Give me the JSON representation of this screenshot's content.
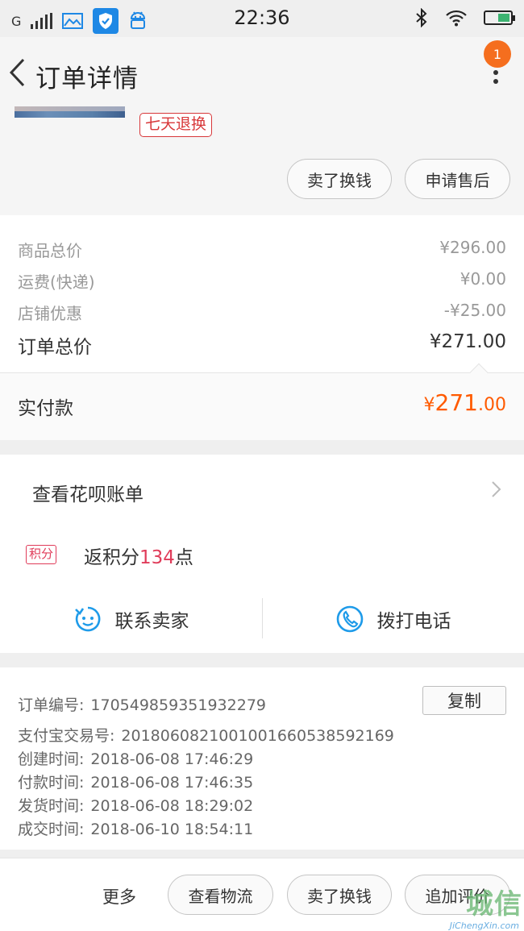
{
  "status_bar": {
    "network": "G",
    "time": "22:36"
  },
  "nav": {
    "title": "订单详情",
    "badge": "1"
  },
  "product": {
    "return_tag": "七天退换",
    "buttons": [
      "卖了换钱",
      "申请售后"
    ]
  },
  "prices": {
    "rows": [
      {
        "label": "商品总价",
        "value": "¥296.00"
      },
      {
        "label": "运费(快递)",
        "value": "¥0.00"
      },
      {
        "label": "店铺优惠",
        "value": "-¥25.00"
      }
    ],
    "total_label": "订单总价",
    "total_value": "¥271.00",
    "paid_label": "实付款",
    "paid_yen": "¥",
    "paid_int": "271",
    "paid_dec": ".00"
  },
  "huabei": {
    "label": "查看花呗账单"
  },
  "points": {
    "tag": "积分",
    "prefix": "返积分",
    "number": "134",
    "suffix": "点"
  },
  "contact": {
    "seller": "联系卖家",
    "phone": "拨打电话"
  },
  "order_info": {
    "copy_label": "复制",
    "rows": [
      {
        "key": "订单编号:",
        "value": "170549859351932279"
      },
      {
        "key": "支付宝交易号:",
        "value": "2018060821001001660538592169"
      },
      {
        "key": "创建时间:",
        "value": "2018-06-08 17:46:29"
      },
      {
        "key": "付款时间:",
        "value": "2018-06-08 17:46:35"
      },
      {
        "key": "发货时间:",
        "value": "2018-06-08 18:29:02"
      },
      {
        "key": "成交时间:",
        "value": "2018-06-10 18:54:11"
      }
    ]
  },
  "bottom_bar": {
    "more": "更多",
    "buttons": [
      "查看物流",
      "卖了换钱",
      "追加评价"
    ]
  },
  "watermark": {
    "cn": "城信",
    "en": "JiChengXin.com"
  },
  "colors": {
    "accent_orange": "#ff5a00",
    "points_red": "#e03c5a",
    "tag_red": "#d8383a",
    "icon_blue": "#1e9be9",
    "badge_orange": "#f56e1e"
  }
}
